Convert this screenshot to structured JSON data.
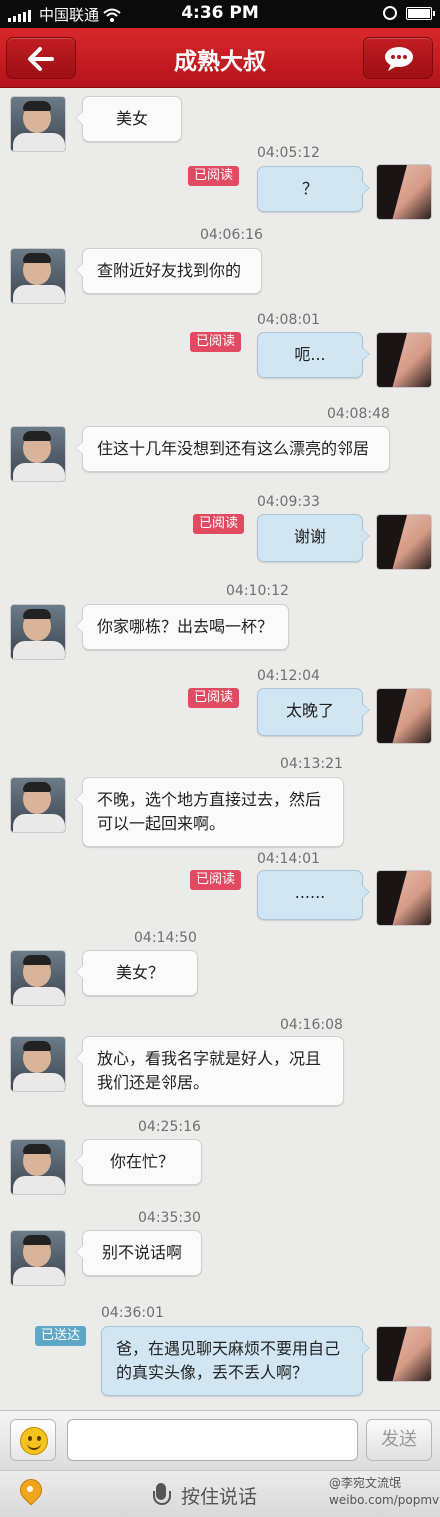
{
  "status_bar": {
    "carrier": "中国联通",
    "time": "4:36 PM"
  },
  "nav": {
    "title": "成熟大叔",
    "back_icon": "arrow-left-icon",
    "compose_icon": "chat-bubble-icon"
  },
  "colors": {
    "nav_red": "#c91d22",
    "read_badge": "#e24a61",
    "delivered_badge": "#5fa7c6",
    "outgoing_bubble": "#d1e6f2",
    "incoming_bubble": "#fafafa"
  },
  "messages": [
    {
      "from": "other",
      "time": "",
      "text": "美女"
    },
    {
      "from": "me",
      "time": "04:05:12",
      "status": "已阅读",
      "text": "？"
    },
    {
      "from": "other",
      "time": "04:06:16",
      "text": "查附近好友找到你的"
    },
    {
      "from": "me",
      "time": "04:08:01",
      "status": "已阅读",
      "text": "呃..."
    },
    {
      "from": "other",
      "time": "04:08:48",
      "text": "住这十几年没想到还有这么漂亮的邻居"
    },
    {
      "from": "me",
      "time": "04:09:33",
      "status": "已阅读",
      "text": "谢谢"
    },
    {
      "from": "other",
      "time": "04:10:12",
      "text": "你家哪栋？出去喝一杯？"
    },
    {
      "from": "me",
      "time": "04:12:04",
      "status": "已阅读",
      "text": "太晚了"
    },
    {
      "from": "other",
      "time": "04:13:21",
      "lines": [
        "不晚，选个地方直接过去，然后",
        "可以一起回来啊。"
      ]
    },
    {
      "from": "me",
      "time": "04:14:01",
      "status": "已阅读",
      "text": "......"
    },
    {
      "from": "other",
      "time": "04:14:50",
      "text": "美女？"
    },
    {
      "from": "other",
      "time": "04:16:08",
      "lines": [
        "放心，看我名字就是好人，况且",
        "我们还是邻居。"
      ]
    },
    {
      "from": "other",
      "time": "04:25:16",
      "text": "你在忙？"
    },
    {
      "from": "other",
      "time": "04:35:30",
      "text": "别不说话啊"
    },
    {
      "from": "me",
      "time": "04:36:01",
      "status": "已送达",
      "lines": [
        "爸，在遇见聊天麻烦不要用自己",
        "的真实头像，丢不丢人啊？"
      ]
    }
  ],
  "input_bar": {
    "emoji_icon": "smiley-icon",
    "input_value": "",
    "send_label": "发送"
  },
  "voice_bar": {
    "location_icon": "location-pin-icon",
    "mic_icon": "microphone-icon",
    "label": "按住说话"
  },
  "watermark": {
    "line1": "@李宛文流氓",
    "line2": "weibo.com/popmv"
  }
}
